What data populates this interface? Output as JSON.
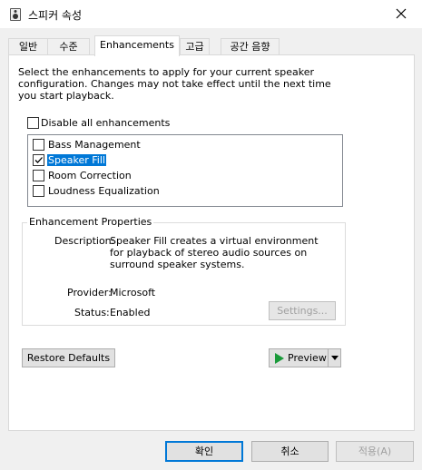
{
  "window": {
    "title": "스피커 속성",
    "close_icon": "close-icon",
    "app_icon": "speaker-icon"
  },
  "tabs": [
    {
      "label": "일반"
    },
    {
      "label": "수준"
    },
    {
      "label": "Enhancements",
      "selected": true
    },
    {
      "label": "고급"
    },
    {
      "label": "공간 음향"
    }
  ],
  "intro": "Select the enhancements to apply for your current speaker configuration. Changes may not take effect until the next time you start playback.",
  "disable_all": {
    "label": "Disable all enhancements",
    "checked": false
  },
  "enhancements": [
    {
      "label": "Bass Management",
      "checked": false
    },
    {
      "label": "Speaker Fill",
      "checked": true,
      "selected": true
    },
    {
      "label": "Room Correction",
      "checked": false
    },
    {
      "label": "Loudness Equalization",
      "checked": false
    }
  ],
  "properties": {
    "title": "Enhancement Properties",
    "description_label": "Description:",
    "description": "Speaker Fill creates a virtual environment for playback of stereo audio sources on surround speaker systems.",
    "provider_label": "Provider:",
    "provider": "Microsoft",
    "status_label": "Status:",
    "status": "Enabled",
    "settings_button": "Settings..."
  },
  "restore_defaults": "Restore Defaults",
  "preview": {
    "label": "Preview",
    "play_icon": "play-icon",
    "dropdown_icon": "dropdown-arrow-icon"
  },
  "footer": {
    "ok": "확인",
    "cancel": "취소",
    "apply": "적용(A)"
  },
  "colors": {
    "accent": "#0078d7",
    "play_green": "#1a9a3a"
  }
}
